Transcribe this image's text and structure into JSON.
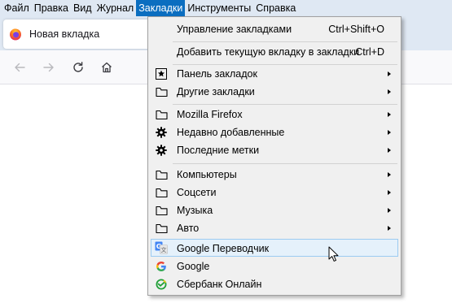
{
  "menubar": {
    "items": [
      "Файл",
      "Правка",
      "Вид",
      "Журнал",
      "Закладки",
      "Инструменты",
      "Справка"
    ],
    "active": "Закладки"
  },
  "tab": {
    "title": "Новая вкладка",
    "icon": "firefox-icon"
  },
  "toolbar": {
    "icons": [
      "back-arrow-icon",
      "forward-arrow-icon",
      "reload-icon",
      "home-icon"
    ]
  },
  "bookmarks_menu": {
    "manage": {
      "label": "Управление закладками",
      "shortcut": "Ctrl+Shift+O"
    },
    "add_current": {
      "label": "Добавить текущую вкладку в закладки",
      "shortcut": "Ctrl+D"
    },
    "toolbar_folder": {
      "label": "Панель закладок",
      "icon": "star-box-icon"
    },
    "other_bookmarks": {
      "label": "Другие закладки",
      "icon": "folder-icon"
    },
    "mozilla_firefox": {
      "label": "Mozilla Firefox",
      "icon": "folder-icon"
    },
    "recently_added": {
      "label": "Недавно добавленные",
      "icon": "gear-icon"
    },
    "recent_tags": {
      "label": "Последние метки",
      "icon": "gear-icon"
    },
    "computers": {
      "label": "Компьютеры",
      "icon": "folder-icon"
    },
    "social": {
      "label": "Соцсети",
      "icon": "folder-icon"
    },
    "music": {
      "label": "Музыка",
      "icon": "folder-icon"
    },
    "auto": {
      "label": "Авто",
      "icon": "folder-icon"
    },
    "google_translate": {
      "label": "Google Переводчик",
      "icon": "google-translate-icon"
    },
    "google": {
      "label": "Google",
      "icon": "google-g-icon"
    },
    "sberbank": {
      "label": "Сбербанк Онлайн",
      "icon": "sberbank-icon"
    }
  },
  "colors": {
    "menubar_bg": "#dfe8f3",
    "menu_active": "#0b6ec0",
    "dropdown_bg": "#f0f0f0",
    "hover_bg": "#e5f1fb",
    "hover_border": "#9ccbf1"
  }
}
